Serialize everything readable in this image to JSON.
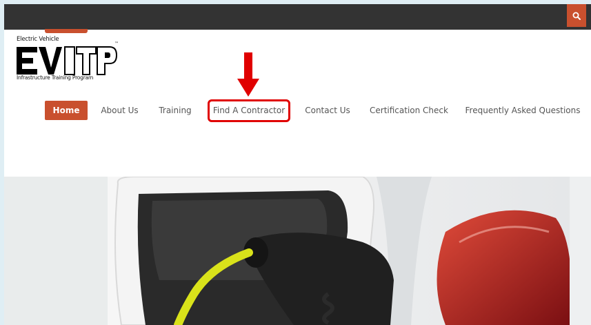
{
  "search": {
    "icon": "search-icon"
  },
  "logo": {
    "top_text": "Electric Vehicle",
    "big_letters": "EVITP",
    "tm": "™",
    "bottom_text": "Infrastructure Training Program"
  },
  "nav": {
    "items": [
      {
        "label": "Home",
        "active": true
      },
      {
        "label": "About Us"
      },
      {
        "label": "Training"
      },
      {
        "label": "Find A Contractor",
        "highlighted": true
      },
      {
        "label": "Contact Us"
      },
      {
        "label": "Certification Check"
      },
      {
        "label": "Frequently Asked Questions"
      }
    ]
  },
  "colors": {
    "accent": "#c9502e",
    "topbar": "#333333",
    "highlight": "#e00000",
    "cable": "#d9e21a"
  },
  "hero": {
    "subject": "ev-charging-plug-photo"
  }
}
